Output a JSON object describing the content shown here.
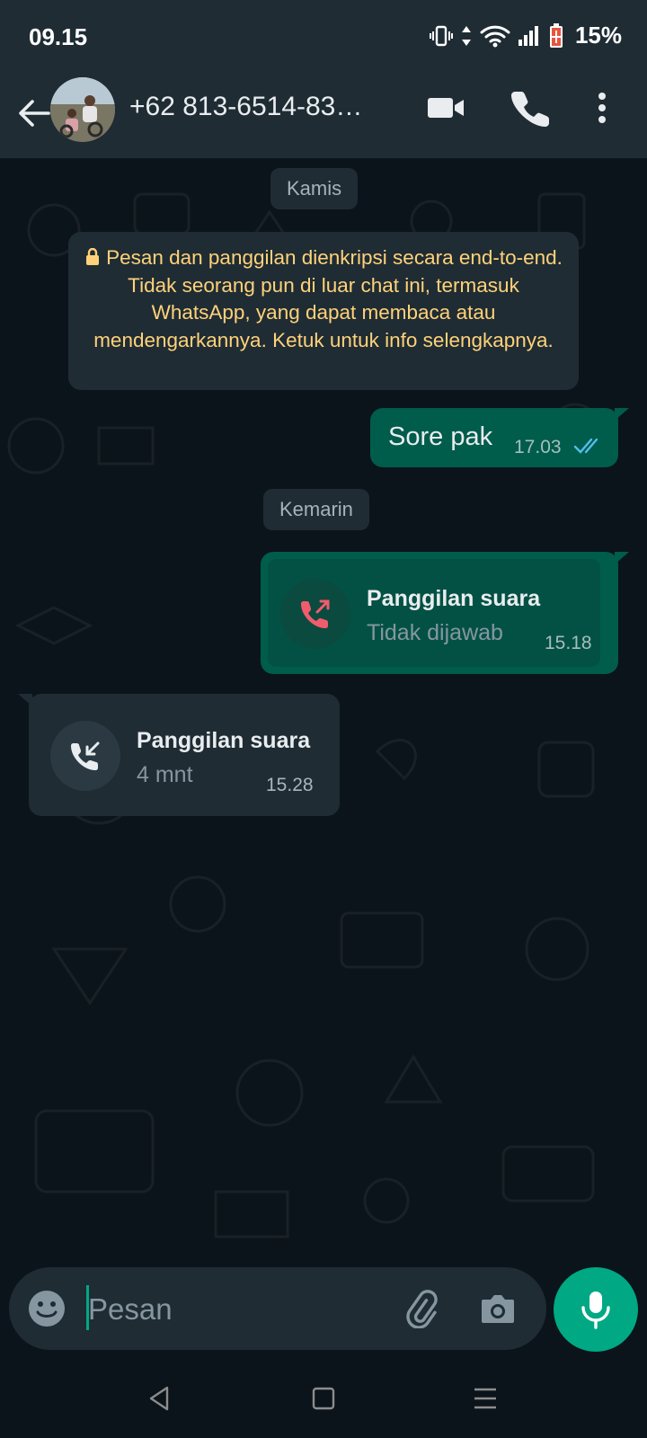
{
  "status_bar": {
    "time": "09.15",
    "battery": "15%",
    "icons": [
      "vibrate-icon",
      "data-arrows-icon",
      "wifi-icon",
      "signal-icon",
      "battery-icon"
    ]
  },
  "header": {
    "contact_name": "+62 813-6514-83…",
    "icons": [
      "back-arrow-icon",
      "video-call-icon",
      "phone-icon",
      "more-vert-icon"
    ]
  },
  "chat": {
    "date_1": "Kamis",
    "encryption_notice": "Pesan dan panggilan dienkripsi secara end-to-end. Tidak seorang pun di luar chat ini, termasuk WhatsApp, yang dapat membaca atau mendengarkannya. Ketuk untuk info selengkapnya.",
    "msg_1": {
      "text": "Sore pak",
      "time": "17.03",
      "status": "read"
    },
    "date_2": "Kemarin",
    "call_1": {
      "title": "Panggilan suara",
      "subtitle": "Tidak dijawab",
      "time": "15.18",
      "direction": "outgoing-missed"
    },
    "call_2": {
      "title": "Panggilan suara",
      "subtitle": "4 mnt",
      "time": "15.28",
      "direction": "incoming"
    }
  },
  "composer": {
    "placeholder": "Pesan",
    "icons": [
      "emoji-icon",
      "attach-icon",
      "camera-icon",
      "mic-icon"
    ]
  },
  "colors": {
    "background": "#0b141a",
    "bar": "#1f2c34",
    "outgoing_bubble": "#005c4b",
    "accent": "#00a884",
    "notice_text": "#ffd279",
    "missed_call": "#f15c6d",
    "read_ticks": "#53bdeb"
  }
}
